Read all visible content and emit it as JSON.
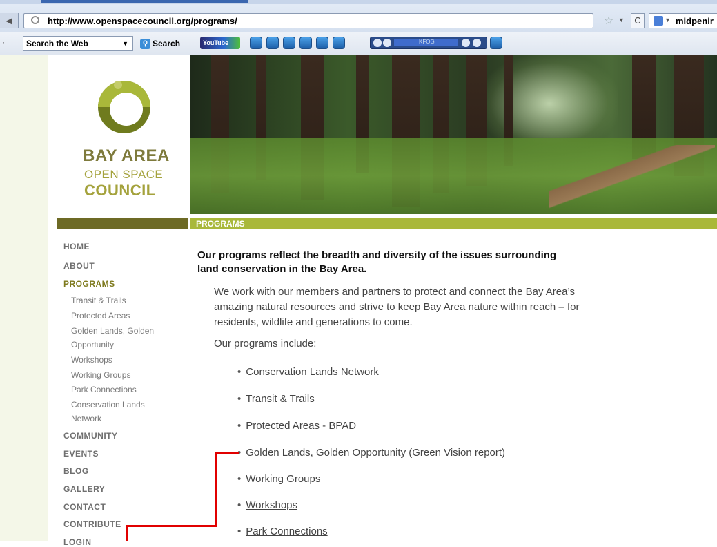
{
  "browser": {
    "url": "http://www.openspacecouncil.org/programs/",
    "search_engine_text": "midpenir",
    "toolbar_search_placeholder": "Search the Web",
    "toolbar_search_button": "Search",
    "youtube_label": "YouTube",
    "radio_station": "KFOG"
  },
  "logo": {
    "line1": "BAY AREA",
    "line2": "OPEN SPACE",
    "line3": "COUNCIL"
  },
  "section_title": "PROGRAMS",
  "sidenav": {
    "main": [
      {
        "label": "HOME"
      },
      {
        "label": "ABOUT"
      },
      {
        "label": "PROGRAMS"
      },
      {
        "label": "COMMUNITY"
      },
      {
        "label": "EVENTS"
      },
      {
        "label": "BLOG"
      },
      {
        "label": "GALLERY"
      },
      {
        "label": "CONTACT"
      },
      {
        "label": "CONTRIBUTE"
      },
      {
        "label": "LOGIN"
      }
    ],
    "sub": [
      {
        "label": "Transit & Trails"
      },
      {
        "label": "Protected Areas"
      },
      {
        "label": "Golden Lands, Golden"
      },
      {
        "label": "Opportunity"
      },
      {
        "label": "Workshops"
      },
      {
        "label": "Working Groups"
      },
      {
        "label": "Park Connections"
      },
      {
        "label": "Conservation Lands"
      },
      {
        "label": "Network"
      }
    ]
  },
  "content": {
    "heading": "Our programs reflect the breadth and diversity of the issues surrounding land conservation in the Bay Area.",
    "paragraph": "We work with our members and partners to protect and connect the Bay Area’s amazing natural resources and strive to keep Bay Area nature within reach – for residents, wildlife and generations to come.",
    "includes_label": "Our programs include:",
    "programs": [
      {
        "label": "Conservation Lands Network"
      },
      {
        "label": "Transit & Trails"
      },
      {
        "label": "Protected Areas - BPAD"
      },
      {
        "label": "Golden Lands, Golden Opportunity (Green Vision report)"
      },
      {
        "label": "Working Groups"
      },
      {
        "label": "Workshops"
      },
      {
        "label": "Park Connections"
      }
    ]
  },
  "colors": {
    "accent_green": "#a9b83a",
    "olive": "#6d6a25",
    "annotation_red": "#e10000"
  }
}
